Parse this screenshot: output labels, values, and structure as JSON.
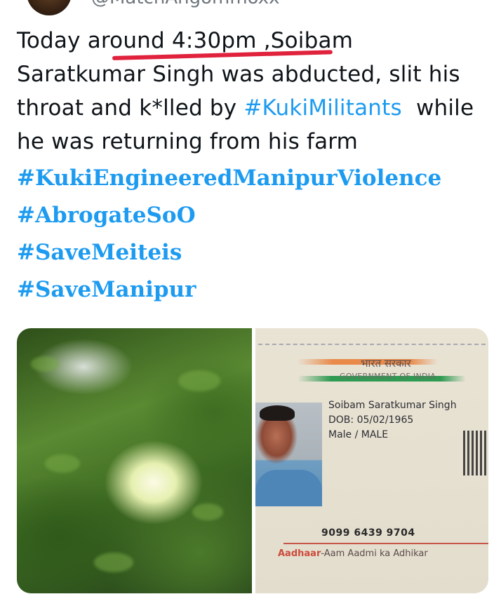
{
  "header": {
    "handle": "@MatchAngommoxx"
  },
  "tweet": {
    "lines": [
      "Today around 4:30pm ,Soibam",
      "Saratkumar Singh was abducted, slit his",
      "throat and k*lled by ",
      "#KukiMilitants",
      "  while",
      "he was returning from his farm"
    ],
    "hashtags": [
      "#KukiEngineeredManipurViolence",
      "#AbrogateSoO",
      "#SaveMeiteis",
      "#SaveManipur"
    ]
  },
  "id_card": {
    "gov_hindi": "भारत सरकार",
    "gov_english": "GOVERNMENT OF INDIA",
    "name": "Soibam Saratkumar Singh",
    "dob": "DOB: 05/02/1965",
    "sex": "Male  / MALE",
    "number": "9099 6439 9704",
    "brand": "Aadhaar",
    "tagline": "-Aam Aadmi ka Adhikar"
  },
  "colors": {
    "link": "#1d9bf0",
    "text": "#0f1419",
    "annotation_underline": "#e0223c"
  }
}
